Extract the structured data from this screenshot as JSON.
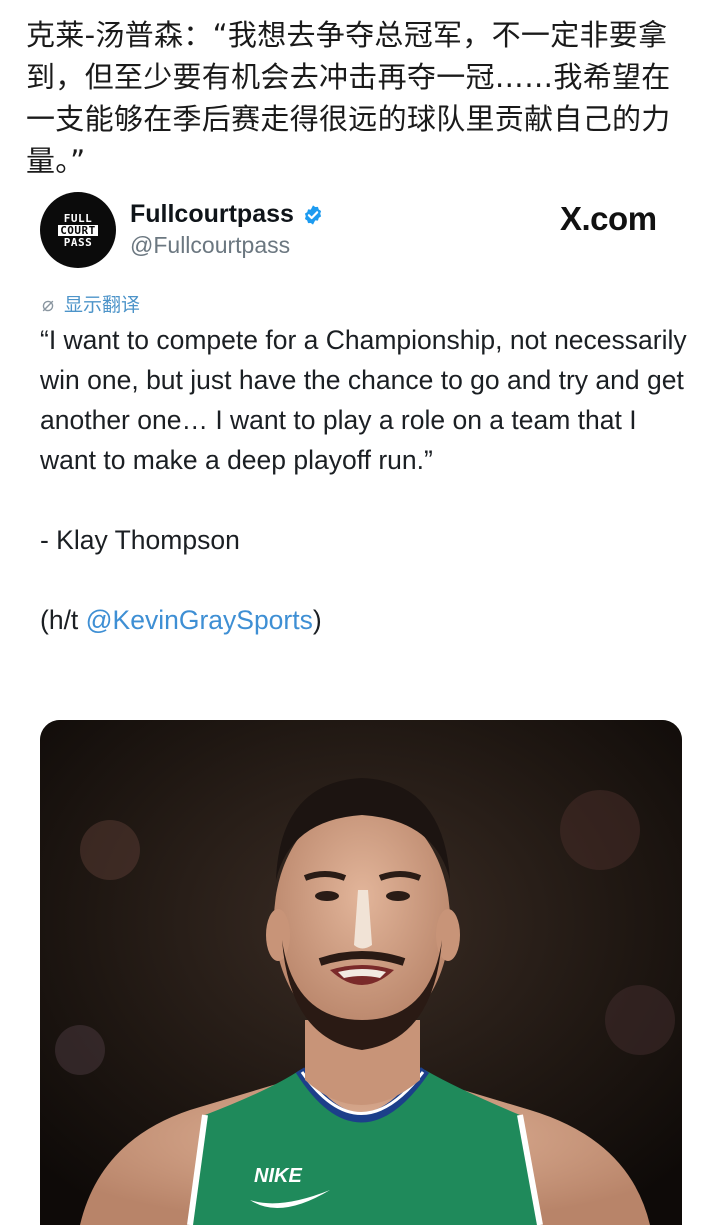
{
  "post": {
    "caption": "克莱-汤普森：“我想去争夺总冠军，不一定非要拿到，但至少要有机会去冲击再夺一冠……我希望在一支能够在季后赛走得很远的球队里贡献自己的力量。”"
  },
  "tweet": {
    "avatar_lines": [
      "FULL",
      "COURT",
      "PASS"
    ],
    "display_name": "Fullcourtpass",
    "handle": "@Fullcourtpass",
    "brand": "X.com",
    "translate_label": "显示翻译",
    "quote": "“I want to compete for a Championship, not necessarily win one, but just have the chance to go and try and get another one… I want to play a role on a team that I want to make a deep playoff run.”",
    "attribution": "- Klay Thompson",
    "hat_tip_prefix": "(h/t ",
    "hat_tip_mention": "@KevinGraySports",
    "hat_tip_suffix": ")",
    "jersey_logo": "NIKE"
  },
  "colors": {
    "verified": "#1d9bf0",
    "mention": "#3e8fd4",
    "jersey": "#1f8a5b"
  },
  "icons": {
    "translate": "globe-icon",
    "verified": "verified-badge-icon"
  }
}
